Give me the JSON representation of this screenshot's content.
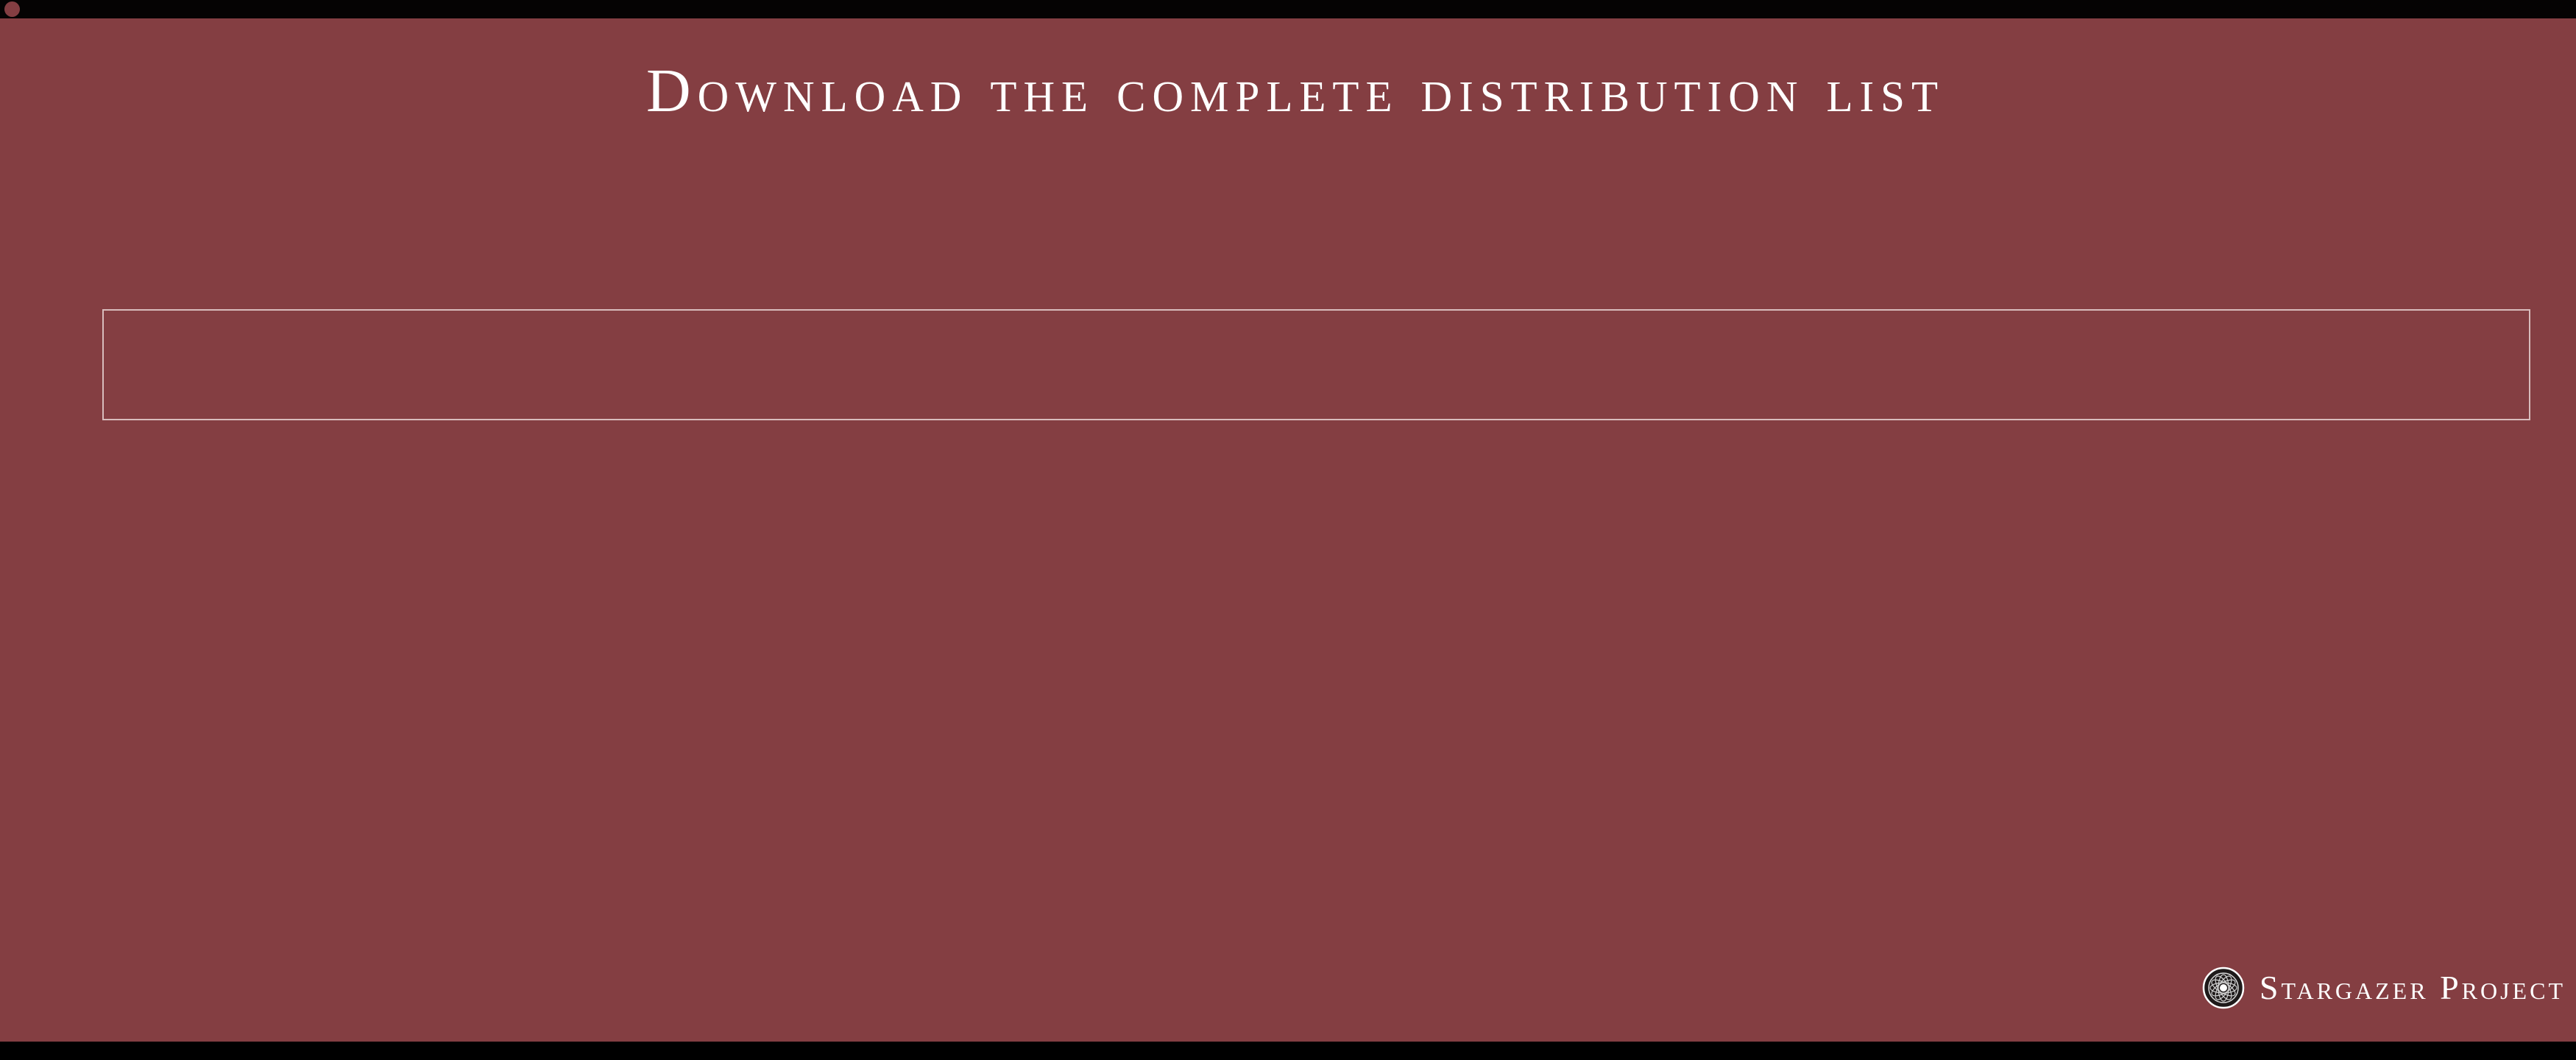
{
  "page": {
    "title": "Download the complete distribution list"
  },
  "download_area": {
    "content": ""
  },
  "brand": {
    "name": "Stargazer Project",
    "logo_icon": "rosette-emblem-icon"
  },
  "colors": {
    "background": "#843e42",
    "text": "#ffffff",
    "border": "#d8bcbc",
    "bars": "#000000"
  }
}
